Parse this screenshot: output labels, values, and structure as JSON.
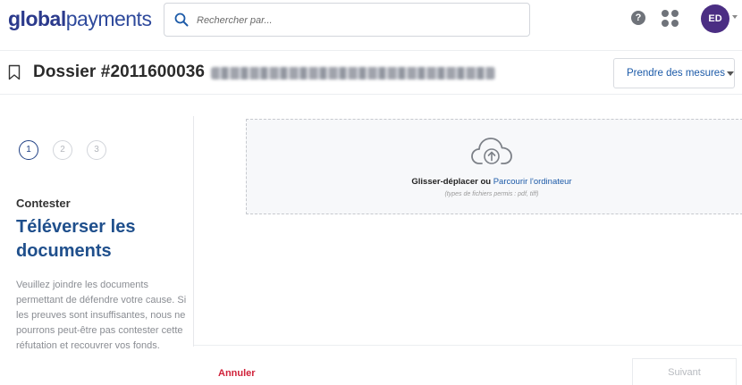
{
  "header": {
    "logo_bold": "global",
    "logo_regular": "payments",
    "search_placeholder": "Rechercher par...",
    "help_label": "?",
    "avatar_initials": "ED"
  },
  "case": {
    "title": "Dossier #2011600036",
    "action_button": "Prendre des mesures"
  },
  "steps": {
    "items": [
      "1",
      "2",
      "3"
    ],
    "active_index": 0,
    "kicker": "Contester",
    "heading": "Téléverser les documents",
    "description": "Veuillez joindre les documents permettant de défendre votre cause. Si les preuves sont insuffisantes, nous ne pourrons peut-être pas contester cette réfutation et recouvrer vos fonds."
  },
  "upload": {
    "drag_text": "Glisser-déplacer ou ",
    "browse_link": "Parcourir l'ordinateur",
    "file_types": "(types de fichiers permis : pdf, tiff)"
  },
  "footer": {
    "cancel_label": "Annuler",
    "next_label": "Suivant"
  },
  "colors": {
    "brand": "#2b3a8c",
    "link": "#1c5aa8",
    "avatar": "#4b2e83",
    "cancel": "#d0223a",
    "heading": "#1f4f8c"
  }
}
